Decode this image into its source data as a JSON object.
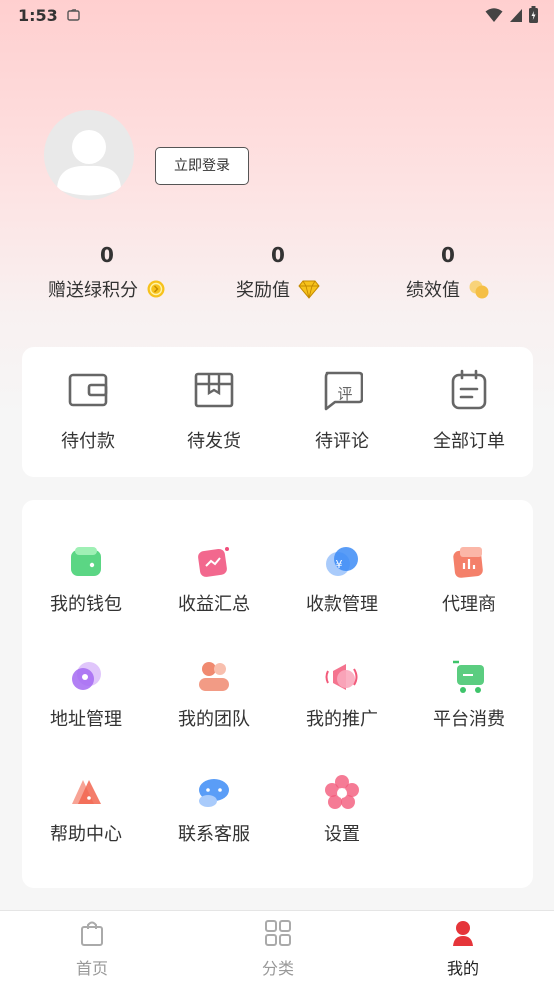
{
  "status_bar": {
    "time": "1:53"
  },
  "profile": {
    "login_label": "立即登录"
  },
  "stats": [
    {
      "value": "0",
      "label": "赠送绿积分",
      "icon": "coin-icon"
    },
    {
      "value": "0",
      "label": "奖励值",
      "icon": "diamond-icon"
    },
    {
      "value": "0",
      "label": "绩效值",
      "icon": "coins-icon"
    }
  ],
  "orders": [
    {
      "label": "待付款",
      "icon": "wallet-outline-icon"
    },
    {
      "label": "待发货",
      "icon": "box-outline-icon"
    },
    {
      "label": "待评论",
      "icon": "comment-outline-icon",
      "badge": "评"
    },
    {
      "label": "全部订单",
      "icon": "clipboard-outline-icon"
    }
  ],
  "services": [
    {
      "label": "我的钱包",
      "icon": "wallet-icon",
      "color": "#3ecf6e"
    },
    {
      "label": "收益汇总",
      "icon": "earnings-icon",
      "color": "#f04d7a"
    },
    {
      "label": "收款管理",
      "icon": "payment-icon",
      "color": "#3d8cf6"
    },
    {
      "label": "代理商",
      "icon": "agent-icon",
      "color": "#f26a50"
    },
    {
      "label": "地址管理",
      "icon": "location-icon",
      "color": "#a56af2"
    },
    {
      "label": "我的团队",
      "icon": "team-icon",
      "color": "#f08a70"
    },
    {
      "label": "我的推广",
      "icon": "promote-icon",
      "color": "#f25a7a"
    },
    {
      "label": "平台消费",
      "icon": "cart-icon",
      "color": "#3ec46a"
    },
    {
      "label": "帮助中心",
      "icon": "help-icon",
      "color": "#f26650"
    },
    {
      "label": "联系客服",
      "icon": "service-icon",
      "color": "#3d8cf6"
    },
    {
      "label": "设置",
      "icon": "settings-icon",
      "color": "#f25a7a"
    }
  ],
  "tabbar": [
    {
      "label": "首页",
      "icon": "bag-icon",
      "active": false
    },
    {
      "label": "分类",
      "icon": "grid-icon",
      "active": false
    },
    {
      "label": "我的",
      "icon": "person-icon",
      "active": true
    }
  ],
  "colors": {
    "accent": "#e5353a",
    "hero_top": "#ffcfcf"
  }
}
